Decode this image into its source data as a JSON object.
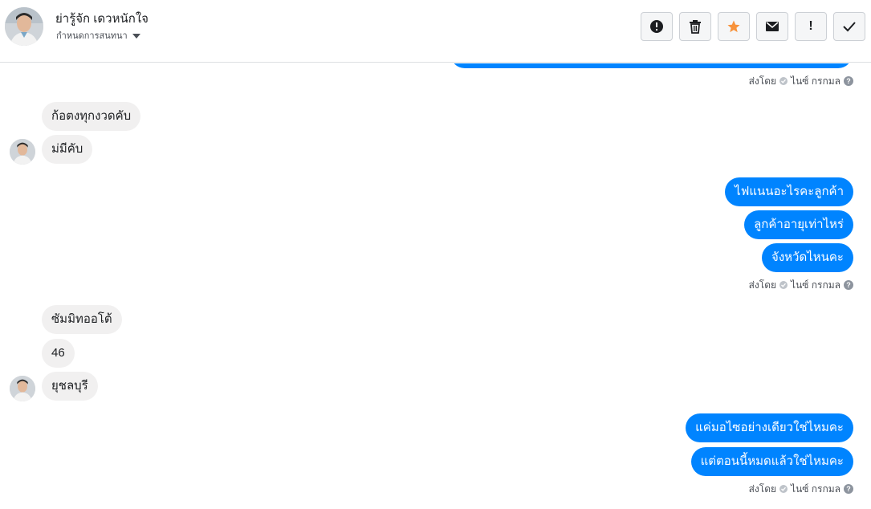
{
  "header": {
    "contact_name": "ย่ารู้จัก เดวหนักใจ",
    "assign_label": "กำหนดการสนทนา"
  },
  "toolbar": {
    "icons": [
      "alert-circle-icon",
      "trash-icon",
      "star-icon",
      "envelope-icon",
      "exclamation-icon",
      "check-icon"
    ],
    "accent": "#f7923b"
  },
  "thread": {
    "sent_by": "ส่งโดย",
    "sender": "ไนซ์ กรกมล",
    "help_glyph": "?",
    "groups": [
      {
        "side": "incoming",
        "messages": [
          "ก้อตงทุกงวดคับ",
          "ม่มีคับ"
        ]
      },
      {
        "side": "outgoing",
        "messages": [
          "ไฟแนนอะไรคะลูกค้า",
          "ลูกค้าอายุเท่าไหร่",
          "จังหวัดไหนคะ"
        ]
      },
      {
        "side": "incoming",
        "messages": [
          "ซัมมิทออโต้",
          "46",
          "ยุชลบุรี"
        ]
      },
      {
        "side": "outgoing",
        "messages": [
          "แค่มอไซอย่างเดียวใช่ไหมคะ",
          "แต่ตอนนี้หมดแล้วใช่ไหมคะ"
        ]
      }
    ]
  },
  "colors": {
    "outgoing_bubble": "#0084ff",
    "incoming_bubble": "#f1f0f0"
  }
}
